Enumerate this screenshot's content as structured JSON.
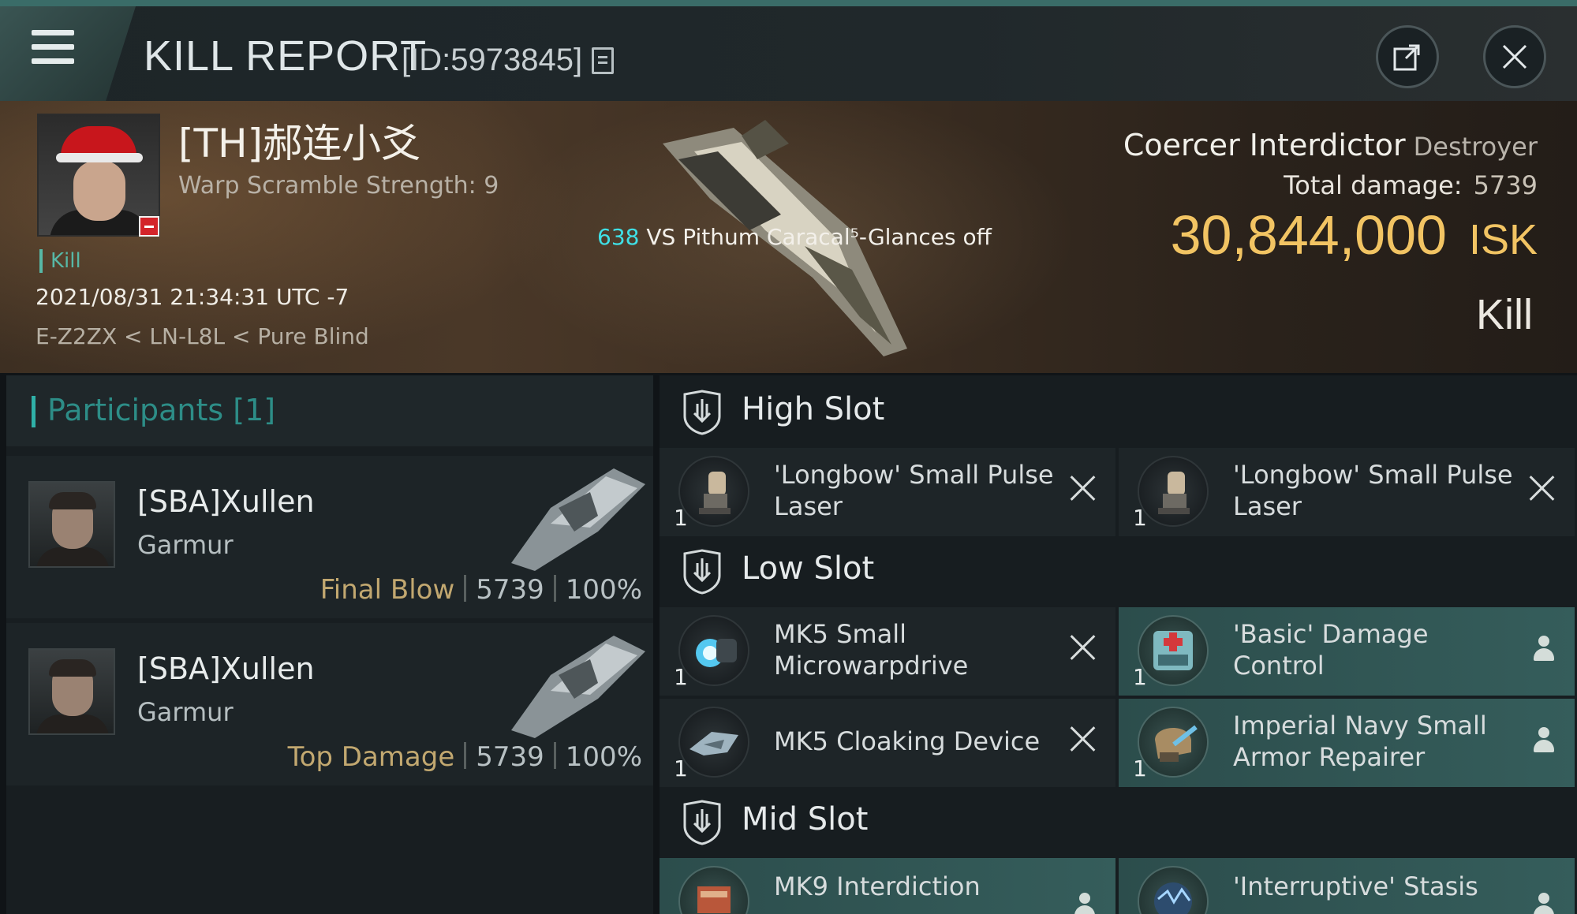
{
  "header": {
    "title": "KILL REPORT",
    "report_id": "[ID:5973845]"
  },
  "victim": {
    "name": "[TH]郝连小爻",
    "warp_scramble": "Warp Scramble Strength: 9",
    "kill_tag": "Kill",
    "datetime": "2021/08/31 21:34:31 UTC -7",
    "location": "E-Z2ZX < LN-L8L < Pure Blind",
    "ship_name": "Coercer Interdictor",
    "ship_class": "Destroyer",
    "total_damage_label": "Total damage:",
    "total_damage_value": "5739",
    "isk_value": "30,844,000",
    "isk_unit": "ISK",
    "result": "Kill"
  },
  "vs": {
    "number": "638",
    "text": "VS Pithum Caracal⁵-Glances off"
  },
  "participants": {
    "title": "Participants [1]",
    "rows": [
      {
        "name": "[SBA]Xullen",
        "ship": "Garmur",
        "role": "Final Blow",
        "damage": "5739",
        "percent": "100%"
      },
      {
        "name": "[SBA]Xullen",
        "ship": "Garmur",
        "role": "Top Damage",
        "damage": "5739",
        "percent": "100%"
      }
    ]
  },
  "slots": {
    "high": {
      "title": "High Slot",
      "modules": [
        {
          "name": "'Longbow' Small Pulse Laser",
          "qty": "1",
          "state": "destroyed",
          "icon": "laser-turret-icon"
        },
        {
          "name": "'Longbow' Small Pulse Laser",
          "qty": "1",
          "state": "destroyed",
          "icon": "laser-turret-icon"
        }
      ]
    },
    "low": {
      "title": "Low Slot",
      "modules": [
        {
          "name": "MK5 Small Microwarpdrive",
          "qty": "1",
          "state": "destroyed",
          "icon": "microwarpdrive-icon"
        },
        {
          "name": "'Basic'  Damage Control",
          "qty": "1",
          "state": "dropped",
          "icon": "damage-control-icon"
        },
        {
          "name": "MK5 Cloaking Device",
          "qty": "1",
          "state": "destroyed",
          "icon": "cloaking-device-icon"
        },
        {
          "name": "Imperial Navy Small Armor Repairer",
          "qty": "1",
          "state": "dropped",
          "icon": "armor-repairer-icon"
        }
      ]
    },
    "mid": {
      "title": "Mid Slot",
      "modules": [
        {
          "name": "MK9 Interdiction",
          "qty": "",
          "state": "dropped",
          "icon": "interdiction-icon"
        },
        {
          "name": "'Interruptive' Stasis",
          "qty": "",
          "state": "dropped",
          "icon": "stasis-icon"
        }
      ]
    }
  },
  "colors": {
    "accent_teal": "#2fb1a8",
    "isk_gold": "#f2c463",
    "vs_cyan": "#3fe0e6",
    "dropped_bg": "#355d5b"
  }
}
